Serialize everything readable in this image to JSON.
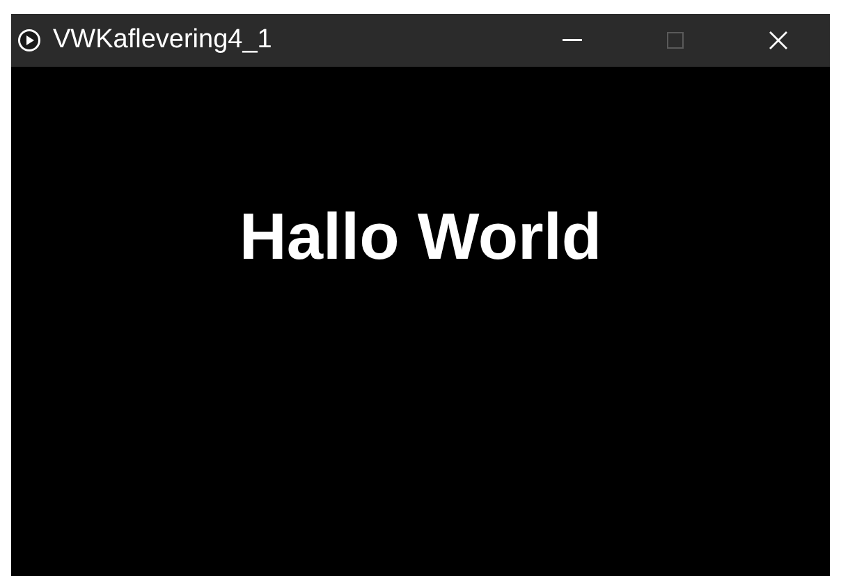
{
  "window": {
    "title": "VWKaflevering4_1",
    "controls": [
      {
        "kind": "minimize",
        "disabled": false
      },
      {
        "kind": "maximize",
        "disabled": true
      },
      {
        "kind": "close",
        "disabled": false
      }
    ]
  },
  "canvas": {
    "text": "Hallo World"
  }
}
